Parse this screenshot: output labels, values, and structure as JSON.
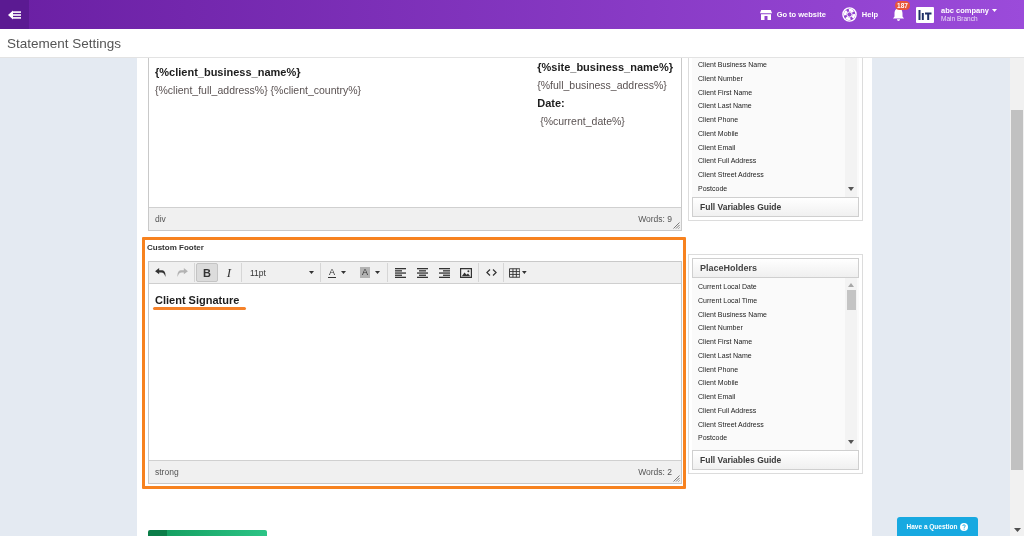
{
  "header": {
    "links": [
      {
        "kind": "website",
        "label": "Go to website"
      },
      {
        "kind": "help",
        "label": "Help"
      }
    ],
    "notification_count": "187",
    "account": {
      "name": "abc company",
      "branch": "Main Branch"
    }
  },
  "page_title": "Statement Settings",
  "header_editor": {
    "columns": [
      [
        {
          "text": "{%client_business_name%}",
          "bold": true,
          "underlined": false
        },
        {
          "text": "{%client_full_address%} {%client_country%}",
          "bold": false,
          "underlined": false
        }
      ],
      [
        {
          "text": "{%site_business_name%}",
          "bold": true,
          "underlined": false
        },
        {
          "text": "{%full_business_address%}",
          "bold": false,
          "underlined": false
        },
        {
          "text": "Date:",
          "bold": true,
          "underlined": false
        },
        {
          "text": " {%current_date%}",
          "bold": false,
          "underlined": false
        }
      ]
    ],
    "status_path": "div",
    "word_count": "Words: 9"
  },
  "placeholders_top": {
    "items": [
      "Client Business Name",
      "Client Number",
      "Client First Name",
      "Client Last Name",
      "Client Phone",
      "Client Mobile",
      "Client Email",
      "Client Full Address",
      "Client Street Address",
      "Postcode"
    ],
    "guide_button": "Full Variables Guide"
  },
  "footer_editor": {
    "label": "Custom Footer",
    "highlighted": true,
    "toolbar": [
      [
        {
          "kind": "undo",
          "disabled": false,
          "pressed": false
        },
        {
          "kind": "redo",
          "disabled": true,
          "pressed": false
        }
      ],
      [
        {
          "kind": "bold",
          "label": "B",
          "disabled": false,
          "pressed": true
        },
        {
          "kind": "italic",
          "label": "I",
          "disabled": false,
          "pressed": false
        }
      ],
      [
        {
          "kind": "select",
          "value": "11pt",
          "disabled": false,
          "pressed": false
        }
      ],
      [
        {
          "kind": "text-color",
          "label": "A",
          "disabled": false,
          "pressed": false
        },
        {
          "kind": "back-color",
          "label": "A",
          "disabled": false,
          "pressed": false
        }
      ],
      [
        {
          "kind": "align-left",
          "disabled": false,
          "pressed": false
        },
        {
          "kind": "align-center",
          "disabled": false,
          "pressed": false
        },
        {
          "kind": "align-right",
          "disabled": false,
          "pressed": false
        },
        {
          "kind": "image",
          "disabled": false,
          "pressed": false
        }
      ],
      [
        {
          "kind": "code",
          "disabled": false,
          "pressed": false
        }
      ],
      [
        {
          "kind": "table",
          "disabled": false,
          "pressed": false
        }
      ]
    ],
    "columns": [
      [
        {
          "text": "Client Signature",
          "bold": true,
          "underlined": true
        }
      ]
    ],
    "status_path": "strong",
    "word_count": "Words: 2"
  },
  "placeholders_bottom": {
    "title": "PlaceHolders",
    "items": [
      "Current Local Date",
      "Current Local Time",
      "Client Business Name",
      "Client Number",
      "Client First Name",
      "Client Last Name",
      "Client Phone",
      "Client Mobile",
      "Client Email",
      "Client Full Address",
      "Client Street Address",
      "Postcode"
    ],
    "guide_button": "Full Variables Guide"
  },
  "help_button": "Have a Question"
}
